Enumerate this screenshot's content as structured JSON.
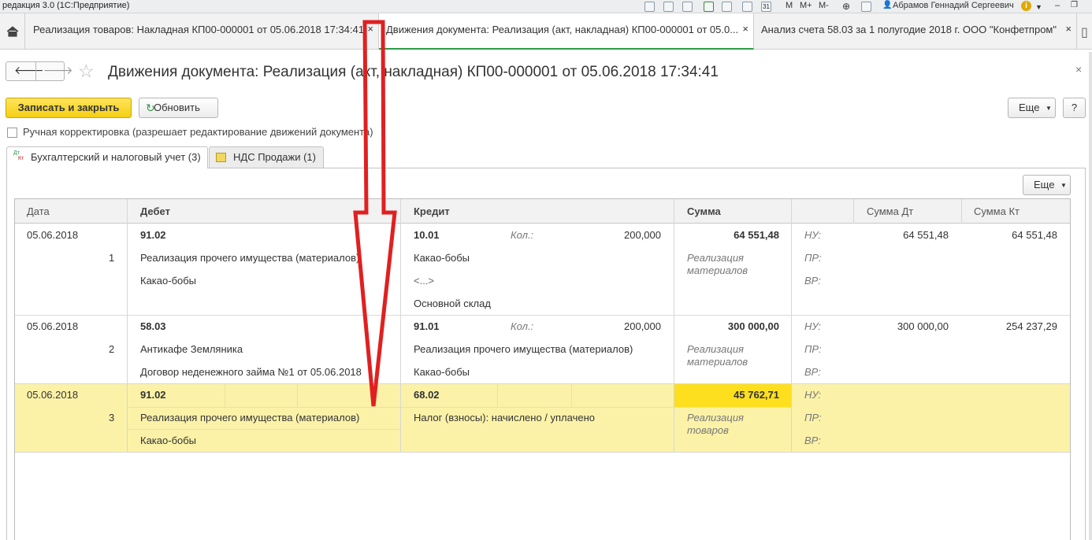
{
  "app_title": "редакция 3.0  (1С:Предприятие)",
  "user_name": "Абрамов Геннадий Сергеевич",
  "toolbar_glyphs": {
    "m": "M",
    "m_plus": "M+",
    "m_minus": "M-",
    "calendar_day": "31"
  },
  "tabs": [
    {
      "label": "Реализация товаров: Накладная КП00-000001 от 05.06.2018 17:34:41",
      "close": "×"
    },
    {
      "label": "Движения документа: Реализация (акт, накладная) КП00-000001 от 05.0...",
      "close": "×"
    },
    {
      "label": "Анализ счета 58.03 за 1 полугодие 2018 г. ООО \"Конфетпром\"",
      "close": "×"
    }
  ],
  "form": {
    "title": "Движения документа: Реализация (акт, накладная) КП00-000001 от 05.06.2018 17:34:41",
    "save_close_label": "Записать и закрыть",
    "refresh_label": "Обновить",
    "more_label": "Еще",
    "help_label": "?",
    "manual_correction_label": "Ручная корректировка (разрешает редактирование движений документа)"
  },
  "subtabs": [
    {
      "label": "Бухгалтерский и налоговый учет (3)",
      "icon_text_top": "Дт",
      "icon_text_bottom": "Кт"
    },
    {
      "label": "НДС Продажи (1)"
    }
  ],
  "grid": {
    "more_label": "Еще",
    "columns": [
      "Дата",
      "Дебет",
      "Кредит",
      "Сумма",
      "",
      "Сумма Дт",
      "Сумма Кт"
    ],
    "rows": [
      {
        "date": "05.06.2018",
        "num": "1",
        "debit_account": "91.02",
        "debit_sub1": "Реализация прочего имущества (материалов)",
        "debit_sub2": "Какао-бобы",
        "credit_account": "10.01",
        "credit_qty_label": "Кол.:",
        "credit_qty": "200,000",
        "credit_sub1": "Какао-бобы",
        "credit_sub2": "<...>",
        "credit_sub3": "Основной склад",
        "amount": "64 551,48",
        "content": "Реализация материалов",
        "nu_label": "НУ:",
        "pr_label": "ПР:",
        "vr_label": "ВР:",
        "sum_dt": "64 551,48",
        "sum_kt": "64 551,48"
      },
      {
        "date": "05.06.2018",
        "num": "2",
        "debit_account": "58.03",
        "debit_sub1": "Антикафе Земляника",
        "debit_sub2": "Договор неденежного займа №1 от 05.06.2018",
        "credit_account": "91.01",
        "credit_qty_label": "Кол.:",
        "credit_qty": "200,000",
        "credit_sub1": "Реализация прочего имущества (материалов)",
        "credit_sub2": "Какао-бобы",
        "amount": "300 000,00",
        "content": "Реализация материалов",
        "nu_label": "НУ:",
        "pr_label": "ПР:",
        "vr_label": "ВР:",
        "sum_dt": "300 000,00",
        "sum_kt": "254 237,29"
      },
      {
        "date": "05.06.2018",
        "num": "3",
        "debit_account": "91.02",
        "debit_sub1": "Реализация прочего имущества (материалов)",
        "debit_sub2": "Какао-бобы",
        "credit_account": "68.02",
        "credit_sub1": "Налог (взносы): начислено / уплачено",
        "amount": "45 762,71",
        "content": "Реализация товаров",
        "nu_label": "НУ:",
        "pr_label": "ПР:",
        "vr_label": "ВР:"
      }
    ]
  },
  "colors": {
    "accent_yellow": "#f5cf13",
    "selected_row": "#fbf2a8",
    "selected_cell": "#fedf1e",
    "active_tab_underline": "#2e9a4a",
    "annotation_arrow": "#e02020"
  }
}
